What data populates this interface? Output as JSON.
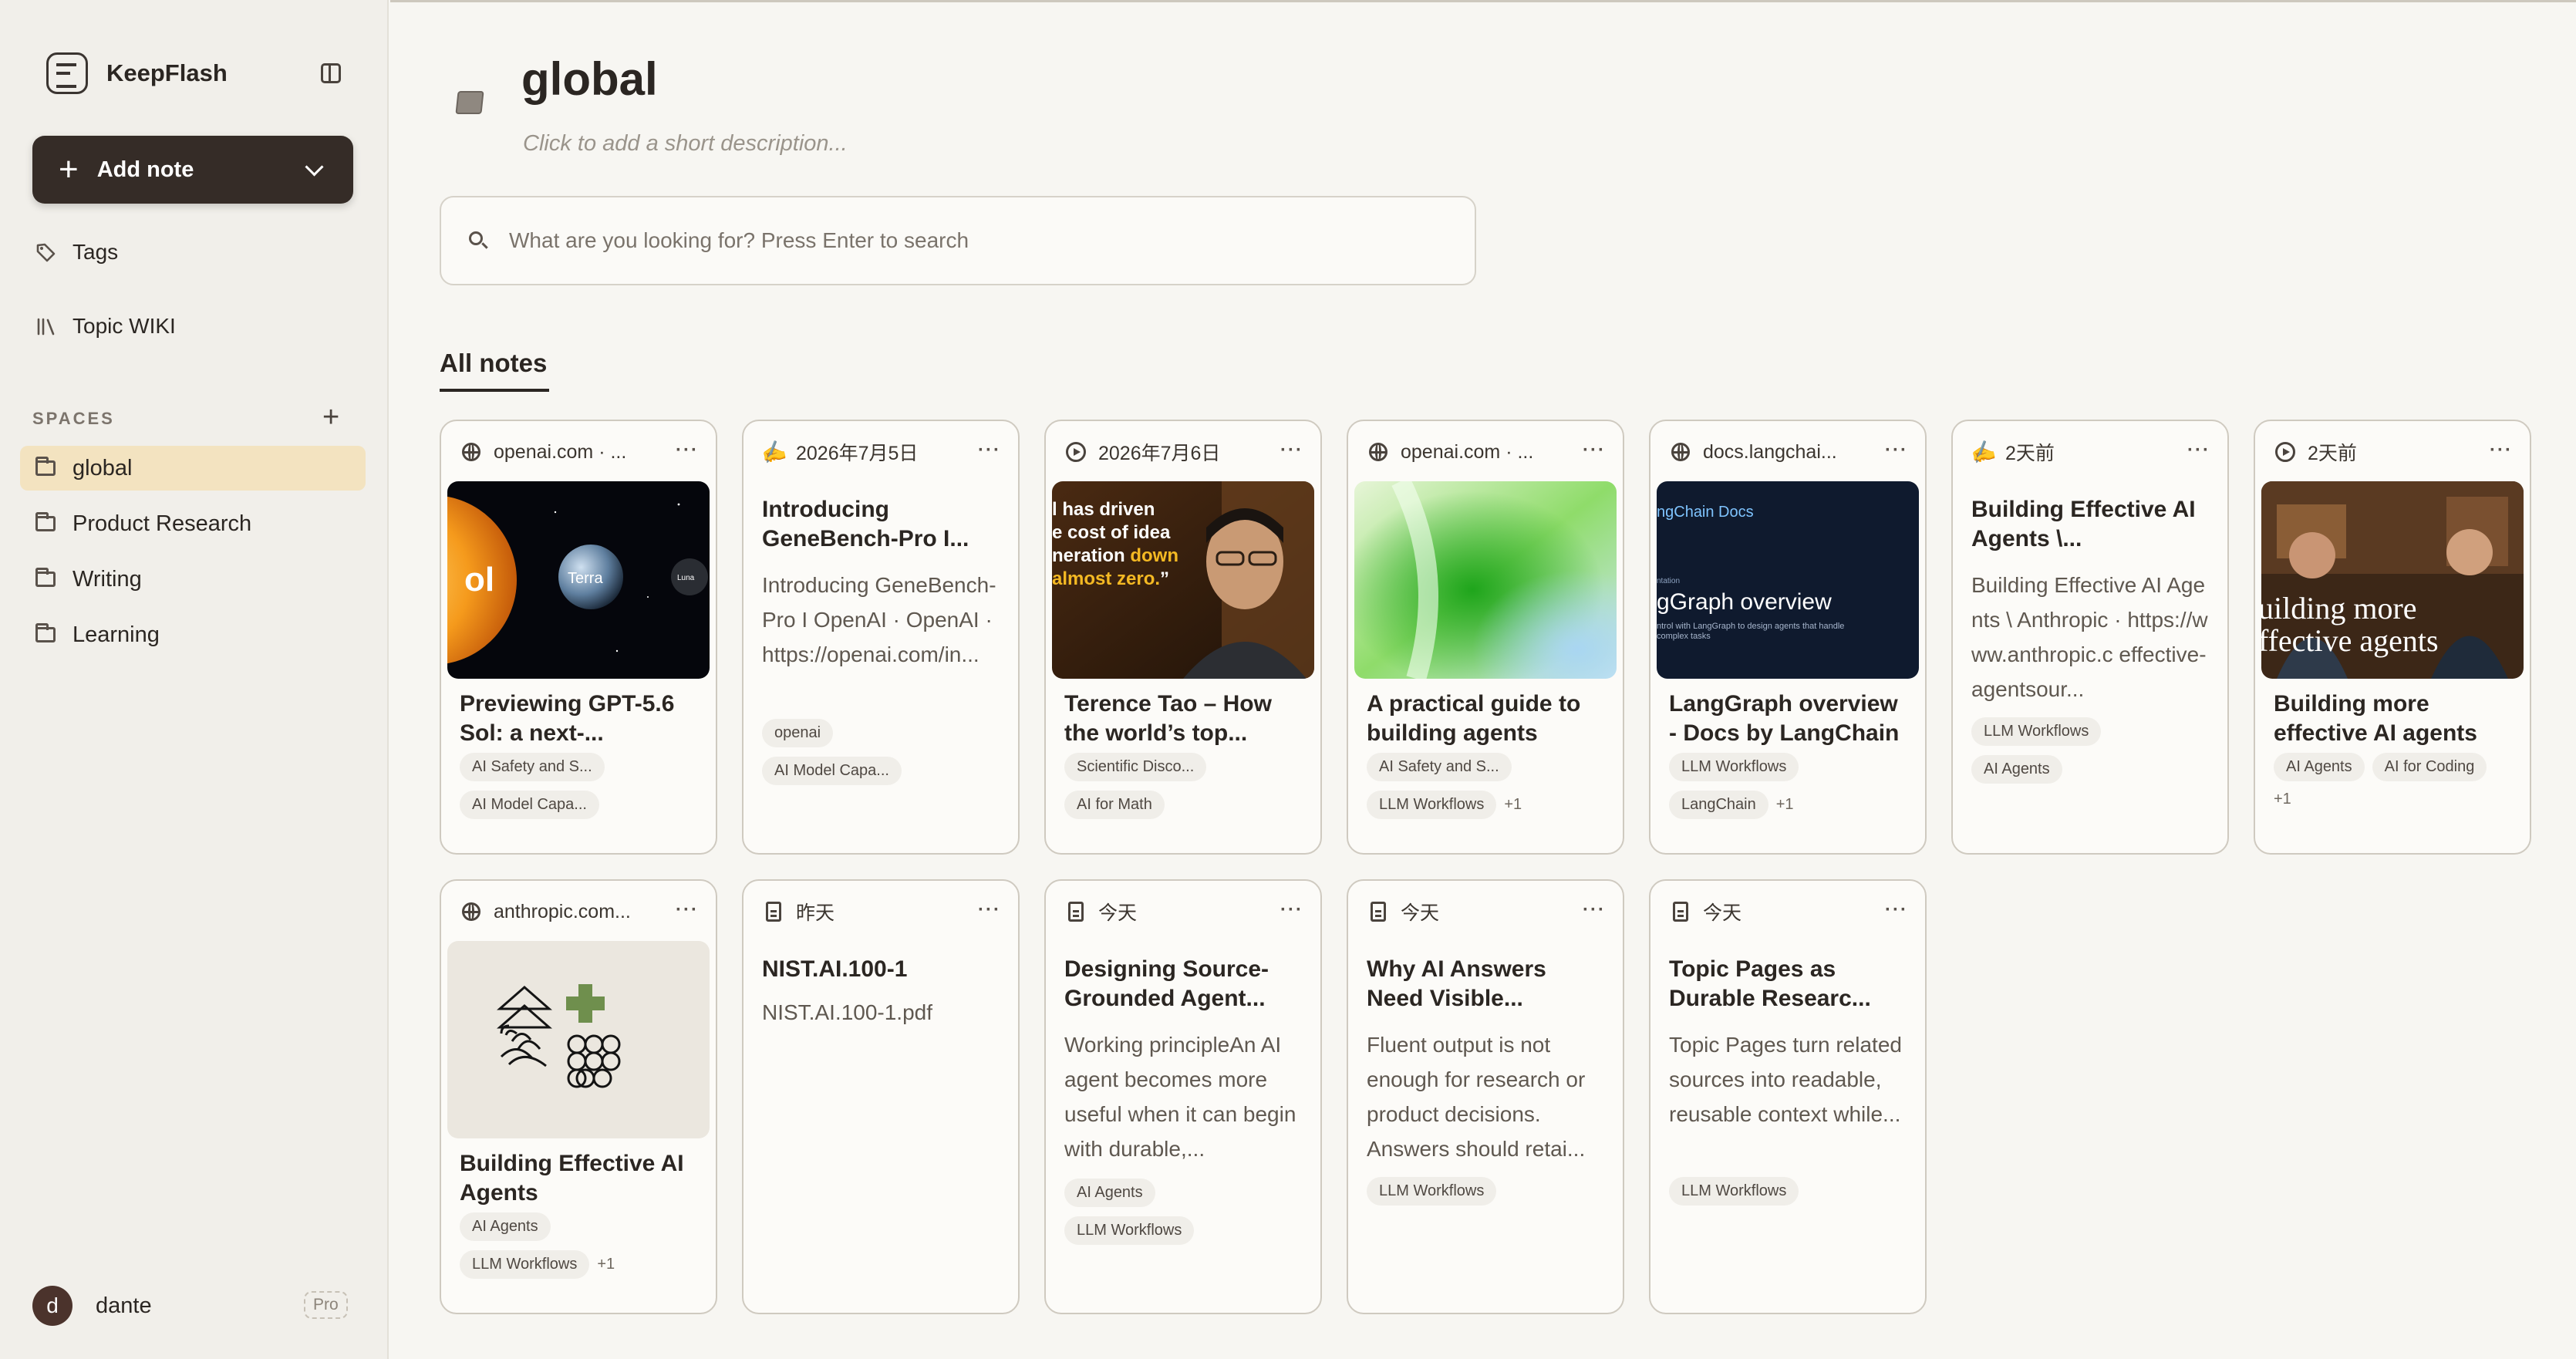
{
  "app": {
    "name": "KeepFlash"
  },
  "sidebar": {
    "add_note_label": "Add note",
    "nav": [
      {
        "label": "Tags",
        "icon": "tag-icon"
      },
      {
        "label": "Topic WIKI",
        "icon": "library-icon"
      }
    ],
    "spaces_title": "SPACES",
    "spaces": [
      {
        "label": "global",
        "active": true
      },
      {
        "label": "Product Research",
        "active": false
      },
      {
        "label": "Writing",
        "active": false
      },
      {
        "label": "Learning",
        "active": false
      }
    ],
    "user": {
      "initial": "d",
      "name": "dante",
      "plan": "Pro"
    }
  },
  "main": {
    "title": "global",
    "description_placeholder": "Click to add a short description...",
    "search_placeholder": "What are you looking for? Press Enter to search",
    "section_tab": "All notes"
  },
  "cards": [
    {
      "source": "openai.com · ...",
      "source_icon": "globe-icon",
      "thumb": "gpt-planets-image",
      "title": "Previewing GPT-5.6 Sol: a next-...",
      "body": "",
      "tags": [
        "AI Safety and S...",
        "AI Model Capa..."
      ],
      "more": ""
    },
    {
      "source": "2026年7月5日",
      "source_icon": "pen-icon",
      "thumb": "",
      "title": "Introducing GeneBench-Pro I...",
      "body": "Introducing GeneBench-Pro I OpenAI · OpenAI · https://openai.com/in...",
      "tags": [
        "openai",
        "AI Model Capa..."
      ],
      "more": ""
    },
    {
      "source": "2026年7月6日",
      "source_icon": "play-icon",
      "thumb": "tao-video-image",
      "thumb_quote": "l has driven e cost of idea neration down almost zero.”",
      "title": "Terence Tao – How the world’s top...",
      "body": "",
      "tags": [
        "Scientific Disco...",
        "AI for Math"
      ],
      "more": ""
    },
    {
      "source": "openai.com · ...",
      "source_icon": "globe-icon",
      "thumb": "green-abstract-image",
      "title": "A practical guide to building agents",
      "body": "",
      "tags": [
        "AI Safety and S...",
        "LLM Workflows"
      ],
      "more": "+1"
    },
    {
      "source": "docs.langchai...",
      "source_icon": "globe-icon",
      "thumb": "langgraph-docs-image",
      "thumb_brand": "ngChain Docs",
      "thumb_heading": "gGraph overview",
      "thumb_sub": "ntrol with LangGraph to design agents that handle complex tasks",
      "thumb_small": "ntation",
      "title": "LangGraph overview - Docs by LangChain",
      "body": "",
      "tags": [
        "LLM Workflows",
        "LangChain"
      ],
      "more": "+1"
    },
    {
      "source": "2天前",
      "source_icon": "pen-icon",
      "thumb": "",
      "title": "Building Effective AI Agents \\...",
      "body": "Building Effective AI Agents \\ Anthropic · https://www.anthropic.c effective-agentsour...",
      "tags": [
        "LLM Workflows",
        "AI Agents"
      ],
      "more": ""
    },
    {
      "source": "2天前",
      "source_icon": "play-icon",
      "thumb": "podcast-image",
      "thumb_overlay": "uilding more ffective agents",
      "title": "Building more effective AI agents",
      "body": "",
      "tags": [
        "AI Agents",
        "AI for Coding"
      ],
      "more": "+1"
    },
    {
      "source": "anthropic.com...",
      "source_icon": "globe-icon",
      "thumb": "anthropic-illustration-image",
      "title": "Building Effective AI Agents",
      "body": "",
      "tags": [
        "AI Agents",
        "LLM Workflows"
      ],
      "more": "+1"
    },
    {
      "source": "昨天",
      "source_icon": "doc-icon",
      "thumb": "",
      "title": "NIST.AI.100-1",
      "body": "NIST.AI.100-1.pdf",
      "tags": [],
      "more": ""
    },
    {
      "source": "今天",
      "source_icon": "doc-icon",
      "thumb": "",
      "title": "Designing Source-Grounded Agent...",
      "body": "Working principleAn AI agent becomes more useful when it can begin with durable,...",
      "tags": [
        "AI Agents",
        "LLM Workflows"
      ],
      "more": ""
    },
    {
      "source": "今天",
      "source_icon": "doc-icon",
      "thumb": "",
      "title": "Why AI Answers Need Visible...",
      "body": "Fluent output is not enough for research or product decisions. Answers should retai...",
      "tags": [
        "LLM Workflows"
      ],
      "more": ""
    },
    {
      "source": "今天",
      "source_icon": "doc-icon",
      "thumb": "",
      "title": "Topic Pages as Durable Researc...",
      "body": "Topic Pages turn related sources into readable, reusable context while...",
      "tags": [
        "LLM Workflows"
      ],
      "more": ""
    }
  ]
}
